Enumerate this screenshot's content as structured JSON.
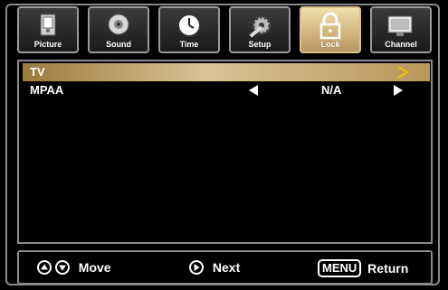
{
  "tabs": [
    {
      "label": "Picture",
      "icon": "picture-icon",
      "active": false
    },
    {
      "label": "Sound",
      "icon": "sound-icon",
      "active": false
    },
    {
      "label": "Time",
      "icon": "time-icon",
      "active": false
    },
    {
      "label": "Setup",
      "icon": "setup-icon",
      "active": false
    },
    {
      "label": "Lock",
      "icon": "lock-icon",
      "active": true
    },
    {
      "label": "Channel",
      "icon": "channel-icon",
      "active": false
    }
  ],
  "menu": {
    "rows": [
      {
        "name": "TV",
        "selected": true
      },
      {
        "name": "MPAA",
        "value": "N/A",
        "selected": false
      }
    ]
  },
  "footer": {
    "move_label": "Move",
    "next_label": "Next",
    "menu_key": "MENU",
    "return_label": "Return"
  },
  "colors": {
    "accent": "#d9c395",
    "frame": "#8a8a8a",
    "background": "#000000",
    "arrow_selected": "#f2c200"
  }
}
